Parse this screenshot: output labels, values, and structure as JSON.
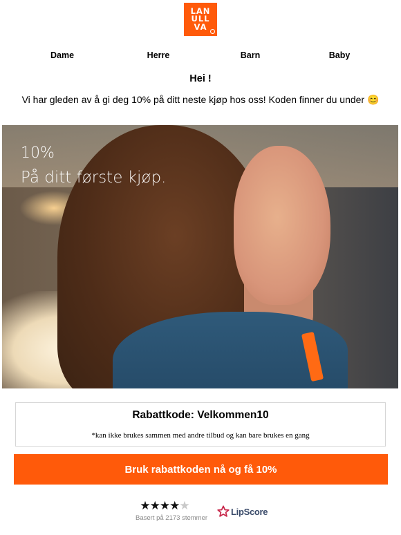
{
  "brand": {
    "logo_lines": [
      "LAN",
      "ULL",
      "VA"
    ],
    "color": "#ff5a0a"
  },
  "nav": {
    "items": [
      {
        "label": "Dame"
      },
      {
        "label": "Herre"
      },
      {
        "label": "Barn"
      },
      {
        "label": "Baby"
      }
    ]
  },
  "greeting": "Hei !",
  "promo_text": "Vi har gleden av å gi deg 10% på ditt neste kjøp hos oss! Koden finner du under 😊",
  "hero": {
    "headline": "10%",
    "subline": "På ditt første kjøp."
  },
  "discount": {
    "title": "Rabattkode: Velkommen10",
    "note": "*kan ikke brukes sammen med andre tilbud og kan bare brukes en gang"
  },
  "cta": {
    "label": "Bruk rabattkoden nå og få 10%"
  },
  "reviews": {
    "stars_full": "★★★★",
    "stars_half": "★",
    "based_on": "Basert på 2173 stemmer",
    "provider": "LipScore",
    "provider_color": "#c8284b"
  }
}
